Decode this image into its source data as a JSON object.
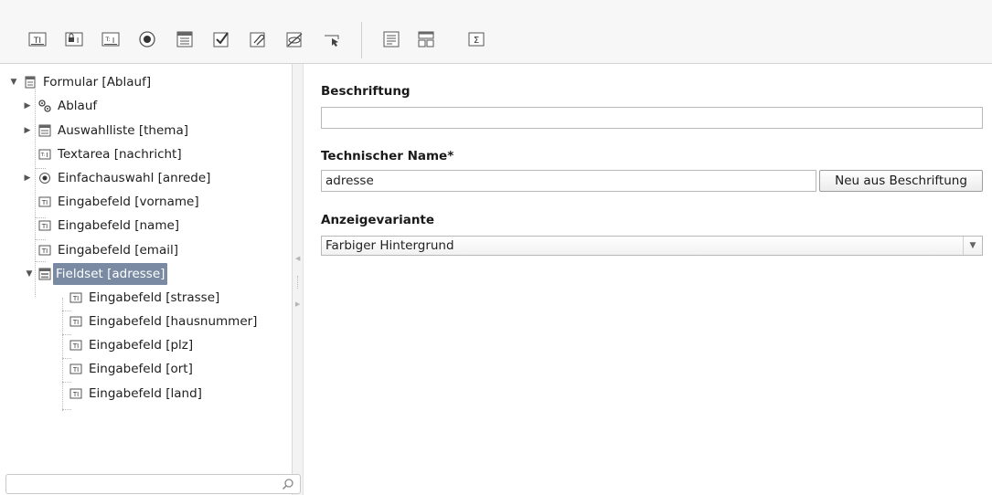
{
  "toolbar": {
    "buttons": [
      {
        "icon": "textfield-icon"
      },
      {
        "icon": "password-field-icon"
      },
      {
        "icon": "textarea-icon"
      },
      {
        "icon": "radio-button-icon"
      },
      {
        "icon": "select-list-icon"
      },
      {
        "icon": "checkbox-icon"
      },
      {
        "icon": "attachment-icon"
      },
      {
        "icon": "hidden-field-icon"
      },
      {
        "icon": "submit-button-icon"
      },
      {
        "icon": "text-block-icon"
      },
      {
        "icon": "fieldset-icon"
      },
      {
        "icon": "sum-icon"
      }
    ]
  },
  "tree": {
    "items": [
      {
        "label": "Formular [Ablauf]",
        "icon": "form-icon"
      },
      {
        "label": "Ablauf",
        "icon": "workflow-icon"
      },
      {
        "label": "Auswahlliste [thema]",
        "icon": "select-list-icon"
      },
      {
        "label": "Textarea [nachricht]",
        "icon": "textarea-icon"
      },
      {
        "label": "Einfachauswahl [anrede]",
        "icon": "radio-button-icon"
      },
      {
        "label": "Eingabefeld [vorname]",
        "icon": "textfield-icon"
      },
      {
        "label": "Eingabefeld [name]",
        "icon": "textfield-icon"
      },
      {
        "label": "Eingabefeld [email]",
        "icon": "textfield-icon"
      },
      {
        "label": "Fieldset [adresse]",
        "icon": "fieldset-icon"
      },
      {
        "label": "Eingabefeld [strasse]",
        "icon": "textfield-icon"
      },
      {
        "label": "Eingabefeld [hausnummer]",
        "icon": "textfield-icon"
      },
      {
        "label": "Eingabefeld [plz]",
        "icon": "textfield-icon"
      },
      {
        "label": "Eingabefeld [ort]",
        "icon": "textfield-icon"
      },
      {
        "label": "Eingabefeld [land]",
        "icon": "textfield-icon"
      }
    ],
    "selected": "Fieldset [adresse]"
  },
  "search": {
    "value": "",
    "icon": "search-icon"
  },
  "properties": {
    "beschriftung_label": "Beschriftung",
    "beschriftung_value": "",
    "technischer_name_label": "Technischer Name*",
    "technischer_name_value": "adresse",
    "neu_button_label": "Neu aus Beschriftung",
    "anzeigevariante_label": "Anzeigevariante",
    "anzeigevariante_value": "Farbiger Hintergrund"
  },
  "colors": {
    "selection": "#7a8aa3",
    "toolbar_bg": "#f7f7f7"
  }
}
